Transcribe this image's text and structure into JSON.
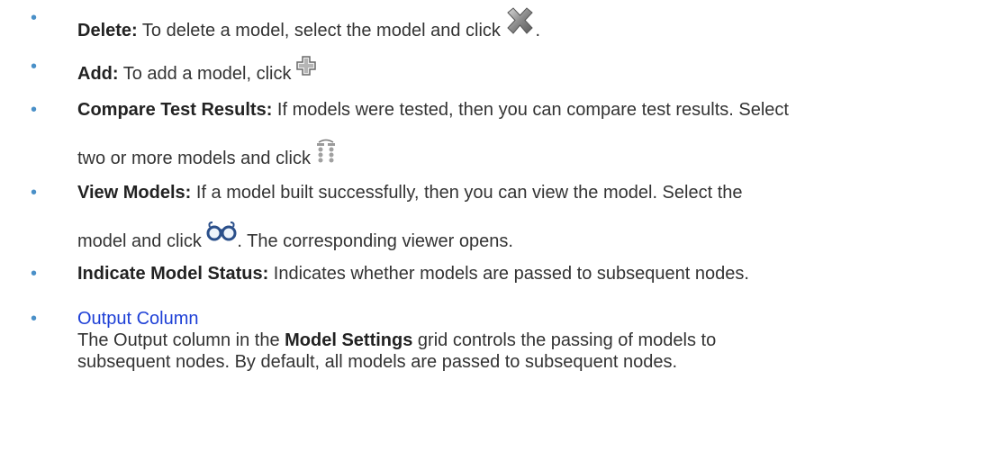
{
  "items": [
    {
      "term": "Delete:",
      "text_before_icon": " To delete a model, select the model and click ",
      "icon": "delete-x-icon",
      "text_after_icon": "."
    },
    {
      "term": "Add:",
      "text_before_icon": " To add a model, click ",
      "icon": "add-plus-icon",
      "text_after_icon": ""
    },
    {
      "term": "Compare Test Results:",
      "text_line1": " If models were tested, then you can compare test results. Select",
      "text_before_icon": "two or more models and click ",
      "icon": "compare-test-results-icon"
    },
    {
      "term": "View Models:",
      "text_line1": " If a model built successfully, then you can view the model. Select the",
      "text_before_icon": "model and click ",
      "icon": "view-models-glasses-icon",
      "text_after_icon": ". The corresponding viewer opens."
    },
    {
      "term": "Indicate Model Status:",
      "text": " Indicates whether models are passed to subsequent nodes."
    },
    {
      "link": "Output Column",
      "para_part1": "The Output column in the ",
      "para_bold": "Model Settings",
      "para_part2": " grid controls the passing of models to",
      "para_line2": "subsequent nodes. By default, all models are passed to subsequent nodes."
    }
  ],
  "colors": {
    "text": "#333333",
    "bullet": "#4a90c8",
    "link": "#1d3fd6"
  }
}
